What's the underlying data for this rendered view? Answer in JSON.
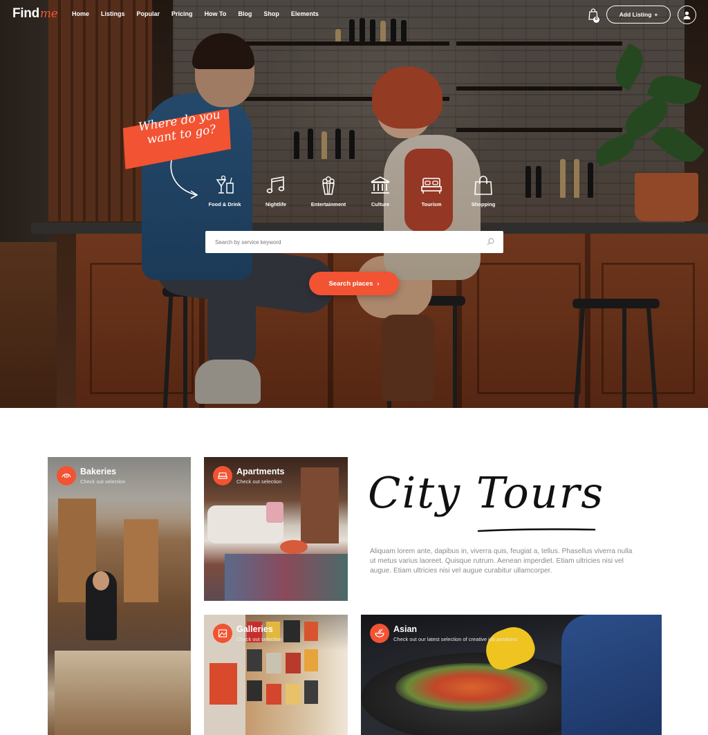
{
  "brand": {
    "name": "Find",
    "accent_word": "me",
    "accent_color": "#f25333"
  },
  "nav": {
    "items": [
      "Home",
      "Listings",
      "Popular",
      "Pricing",
      "How To",
      "Blog",
      "Shop",
      "Elements"
    ]
  },
  "header": {
    "cart_count": "0",
    "add_listing_label": "Add Listing",
    "add_listing_icon": "+",
    "cart_icon": "shopping-bag-icon",
    "user_icon": "user-icon"
  },
  "hero": {
    "tagline_line1": "Where do you",
    "tagline_line2": "want to go?",
    "categories": [
      {
        "label": "Food & Drink",
        "icon": "drink-icon"
      },
      {
        "label": "Nightlife",
        "icon": "music-note-icon"
      },
      {
        "label": "Entertainment",
        "icon": "popcorn-icon"
      },
      {
        "label": "Culture",
        "icon": "museum-icon"
      },
      {
        "label": "Tourism",
        "icon": "bed-icon"
      },
      {
        "label": "Shopping",
        "icon": "shopping-bag-icon"
      }
    ],
    "search_placeholder": "Search by service keyword",
    "search_button_label": "Search places",
    "search_button_icon": "›"
  },
  "cards": [
    {
      "title": "Bakeries",
      "subtitle": "Check out selection",
      "icon": "croissant-icon"
    },
    {
      "title": "Apartments",
      "subtitle": "Check out selection",
      "icon": "bed-icon"
    },
    {
      "title": "Galleries",
      "subtitle": "Check out selection",
      "icon": "picture-icon"
    },
    {
      "title": "Asian",
      "subtitle": "Check out our latest selection of creative job positions",
      "icon": "asian-food-icon"
    }
  ],
  "city_tours": {
    "title": "City Tours",
    "text": "Aliquam lorem ante, dapibus in, viverra quis, feugiat a, tellus. Phasellus viverra nulla ut metus varius laoreet. Quisque rutrum. Aenean imperdiet. Etiam ultricies nisi vel augue. Etiam ultricies nisi vel augue curabitur ullamcorper."
  },
  "colors": {
    "accent": "#f25333",
    "text_muted": "#8a8a8a",
    "white": "#ffffff"
  }
}
